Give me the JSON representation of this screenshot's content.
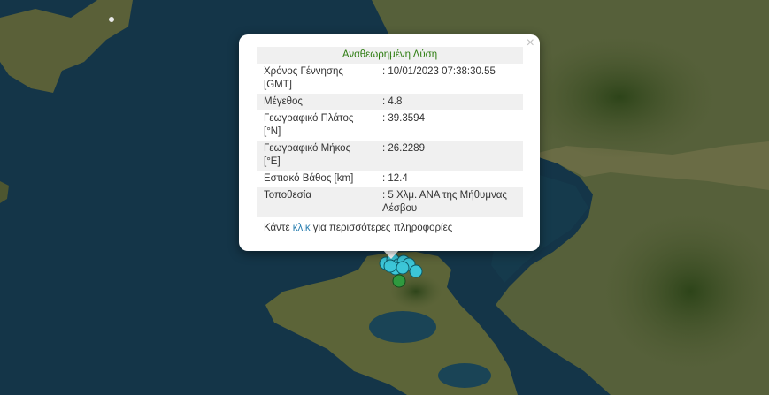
{
  "popup": {
    "title": "Αναθεωρημένη Λύση",
    "close_glyph": "×",
    "rows": [
      {
        "label": "Χρόνος Γέννησης [GMT]",
        "value": ": 10/01/2023 07:38:30.55"
      },
      {
        "label": "Μέγεθος",
        "value": ": 4.8"
      },
      {
        "label": "Γεωγραφικό Πλάτος [°N]",
        "value": ": 39.3594"
      },
      {
        "label": "Γεωγραφικό Μήκος [°E]",
        "value": ": 26.2289"
      },
      {
        "label": "Εστιακό Βάθος [km]",
        "value": ": 12.4"
      },
      {
        "label": "Τοποθεσία",
        "value": ": 5 Χλμ. ΑΝΑ της Μήθυμνας Λέσβου"
      }
    ],
    "more_prefix": "Κάντε ",
    "more_link": "κλικ",
    "more_suffix": " για περισσότερες πληροφορίες"
  },
  "markers": {
    "recent_color": "#3cc6d8",
    "older_color": "#2f9a3f",
    "count_recent": 9,
    "count_older": 1
  },
  "colors": {
    "sea": "#143548",
    "land": "#4f5a34",
    "title_green": "#2e7d12",
    "link_blue": "#2a7fb0"
  }
}
